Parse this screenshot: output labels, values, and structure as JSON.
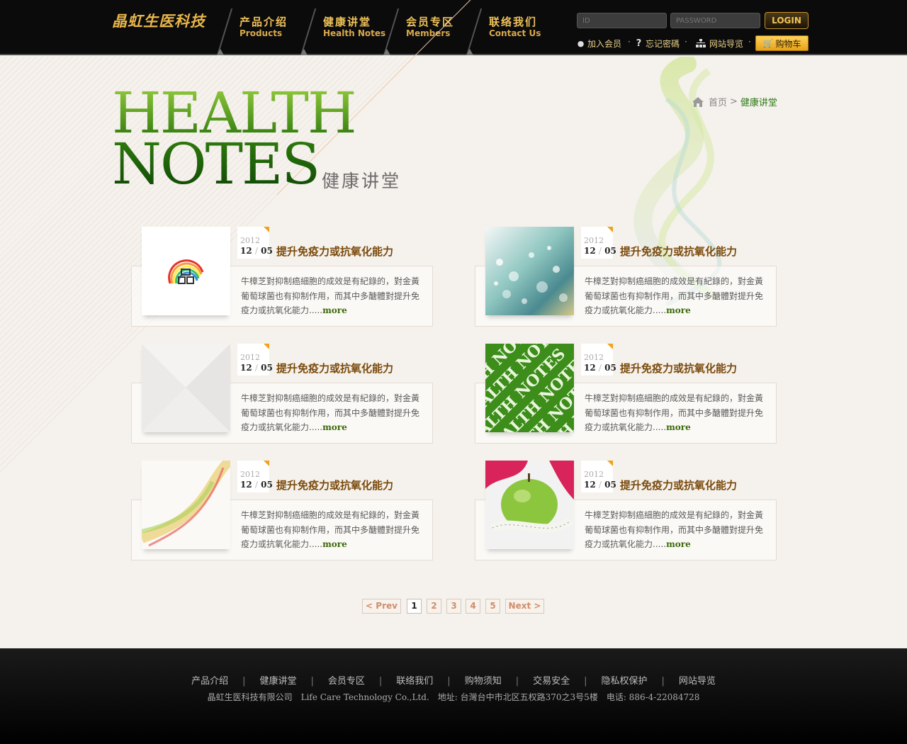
{
  "header": {
    "logo": "晶虹生医科技",
    "nav": [
      {
        "zh": "产品介绍",
        "en": "Products"
      },
      {
        "zh": "健康讲堂",
        "en": "Health Notes"
      },
      {
        "zh": "会员专区",
        "en": "Members"
      },
      {
        "zh": "联络我们",
        "en": "Contact Us"
      }
    ],
    "login": {
      "id_placeholder": "ID",
      "pw_placeholder": "PASSWORD",
      "button": "LOGIN"
    },
    "util": {
      "join": "加入会员",
      "forgot": "忘记密碼",
      "sitemap": "网站导览",
      "cart": "购物车"
    }
  },
  "hero": {
    "title_line1": "HEALTH",
    "title_line2": "NOTES",
    "subtitle": "健康讲堂"
  },
  "breadcrumb": {
    "home": "首页",
    "sep": ">",
    "current": "健康讲堂"
  },
  "articles": [
    {
      "year": "2012",
      "month": "12",
      "day": "05",
      "title": "提升免疫力或抗氧化能力",
      "excerpt": "牛樟芝對抑制癌細胞的成效是有紀錄的，對金黃葡萄球菌也有抑制作用，而其中多醣體對提升免疫力或抗氧化能力.....",
      "more": "more",
      "thumb": "logo-thumbnail"
    },
    {
      "year": "2012",
      "month": "12",
      "day": "05",
      "title": "提升免疫力或抗氧化能力",
      "excerpt": "牛樟芝對抑制癌細胞的成效是有紀錄的，對金黃葡萄球菌也有抑制作用，而其中多醣體對提升免疫力或抗氧化能力.....",
      "more": "more",
      "thumb": "bokeh-thumbnail"
    },
    {
      "year": "2012",
      "month": "12",
      "day": "05",
      "title": "提升免疫力或抗氧化能力",
      "excerpt": "牛樟芝對抑制癌細胞的成效是有紀錄的，對金黃葡萄球菌也有抑制作用，而其中多醣體對提升免疫力或抗氧化能力.....",
      "more": "more",
      "thumb": "envelope-thumbnail"
    },
    {
      "year": "2012",
      "month": "12",
      "day": "05",
      "title": "提升免疫力或抗氧化能力",
      "excerpt": "牛樟芝對抑制癌細胞的成效是有紀錄的，對金黃葡萄球菌也有抑制作用，而其中多醣體對提升免疫力或抗氧化能力.....",
      "more": "more",
      "thumb": "health-notes-thumbnail",
      "thumb_text": "HEALTH NOTES"
    },
    {
      "year": "2012",
      "month": "12",
      "day": "05",
      "title": "提升免疫力或抗氧化能力",
      "excerpt": "牛樟芝對抑制癌細胞的成效是有紀錄的，對金黃葡萄球菌也有抑制作用，而其中多醣體對提升免疫力或抗氧化能力.....",
      "more": "more",
      "thumb": "smoke-thumbnail"
    },
    {
      "year": "2012",
      "month": "12",
      "day": "05",
      "title": "提升免疫力或抗氧化能力",
      "excerpt": "牛樟芝對抑制癌細胞的成效是有紀錄的，對金黃葡萄球菌也有抑制作用，而其中多醣體對提升免疫力或抗氧化能力.....",
      "more": "more",
      "thumb": "apple-thumbnail"
    }
  ],
  "pagination": {
    "prev": "< Prev",
    "next": "Next >",
    "pages": [
      "1",
      "2",
      "3",
      "4",
      "5"
    ],
    "current": "1"
  },
  "footer": {
    "nav": [
      "产品介绍",
      "健康讲堂",
      "会员专区",
      "联络我们",
      "购物须知",
      "交易安全",
      "隐私权保护",
      "网站导览"
    ],
    "company": "晶虹生医科技有限公司",
    "company_en": "Life Care Technology Co.,Ltd.",
    "address": "地址: 台灣台中市北区五权路370之3号5楼",
    "phone": "电话: 886-4-22084728"
  },
  "colors": {
    "brand_gold": "#e8b64a",
    "brand_green": "#3f8d16",
    "title_brown": "#7a4a0c",
    "accent_orange": "#f0a21a"
  }
}
